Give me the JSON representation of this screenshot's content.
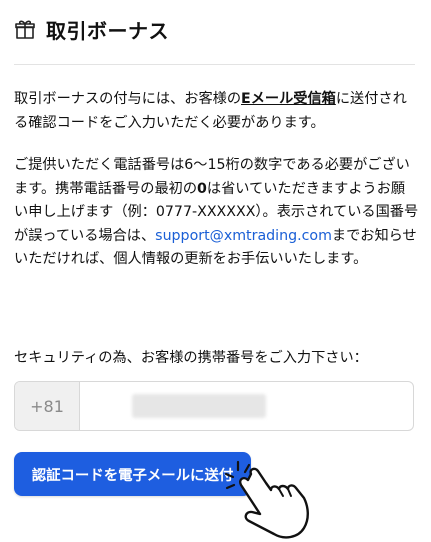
{
  "header": {
    "icon": "gift-icon",
    "title": "取引ボーナス"
  },
  "body": {
    "p1_before": "取引ボーナスの付与には、お客様の",
    "p1_link": "Eメール受信箱",
    "p1_after": "に送付される確認コードをご入力いただく必要があります。",
    "p2_a": "ご提供いただく電話番号は6〜15桁の数字である必要がございます。携帯電話番号の最初の",
    "p2_bold": "0",
    "p2_b": "は省いていただきますようお願い申し上げます（例：0777-XXXXXX）。表示されている国番号が誤っている場合は、",
    "p2_email": "support@xmtrading.com",
    "p2_c": "までお知らせいただければ、個人情報の更新をお手伝いいたします。"
  },
  "phone": {
    "label": "セキュリティの為、お客様の携帯番号をご入力下さい：",
    "country_code": "+81"
  },
  "button": {
    "label": "認証コードを電子メールに送付"
  },
  "colors": {
    "accent": "#1e5ee0",
    "link": "#1a5fd6"
  }
}
